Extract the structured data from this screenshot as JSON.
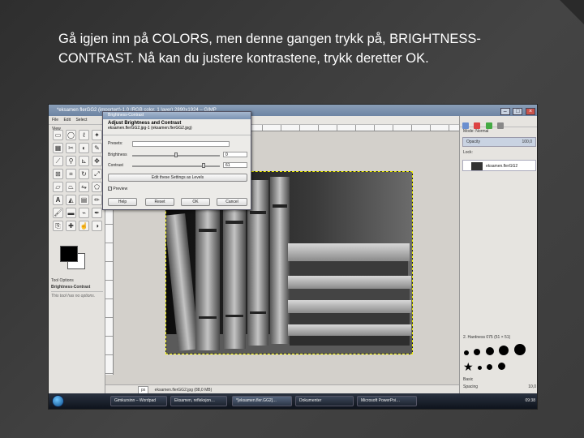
{
  "caption": {
    "line1": "Gå igjen inn på COLORS, men denne gangen trykk på, BRIGHTNESS-",
    "line2": "CONTRAST. Nå kan du justere kontrastene, trykk deretter OK."
  },
  "gimp_window": {
    "title": "*eksamen flerGG2 (importert)-1.0 (RGB color, 1 layer) 2890x1924 – GIMP"
  },
  "toolbox": {
    "menu": [
      "File",
      "Edit",
      "Select",
      "View"
    ],
    "tool_options_title": "Tool Options",
    "tool_options_name": "Brightness-Contrast",
    "tool_options_note": "This tool has no options."
  },
  "dialog": {
    "title": "Brightness-Contrast",
    "heading": "Adjust Brightness and Contrast",
    "subheading": "eksamen.flerGG2.jpg-1 (eksamen.flerGG2.jpg)",
    "presets_label": "Presets:",
    "brightness_label": "Brightness",
    "brightness_value": "0",
    "contrast_label": "Contrast",
    "contrast_value": "61",
    "levels_button": "Edit these Settings as Levels",
    "preview_label": "Preview",
    "help_button": "Help",
    "reset_button": "Reset",
    "ok_button": "OK",
    "cancel_button": "Cancel"
  },
  "status": {
    "zoom": "px",
    "text": "eksamen.flerGG2.jpg (88,0 MB)"
  },
  "dock": {
    "mode": "Mode: Normal",
    "opacity": "Opacity",
    "opacity_value": "100,0",
    "lock": "Lock:",
    "layer_name": "eksamen.flerGG2",
    "brush_header": "2. Hardness 075 (51 × 51)",
    "brush_set": "Basic",
    "spacing": "Spacing",
    "spacing_value": "10,0"
  },
  "taskbar": {
    "tasks": [
      "Gimkursinn – Wordpad",
      "Eksamen, refleksjon…",
      "*[eksamen.fler.GG2]…",
      "Dokumenter",
      "Microsoft PowerPoi…"
    ],
    "clock": "09:38"
  },
  "colors": {
    "titlebar": "#7b93b3",
    "selection": "#c9d3e2"
  }
}
